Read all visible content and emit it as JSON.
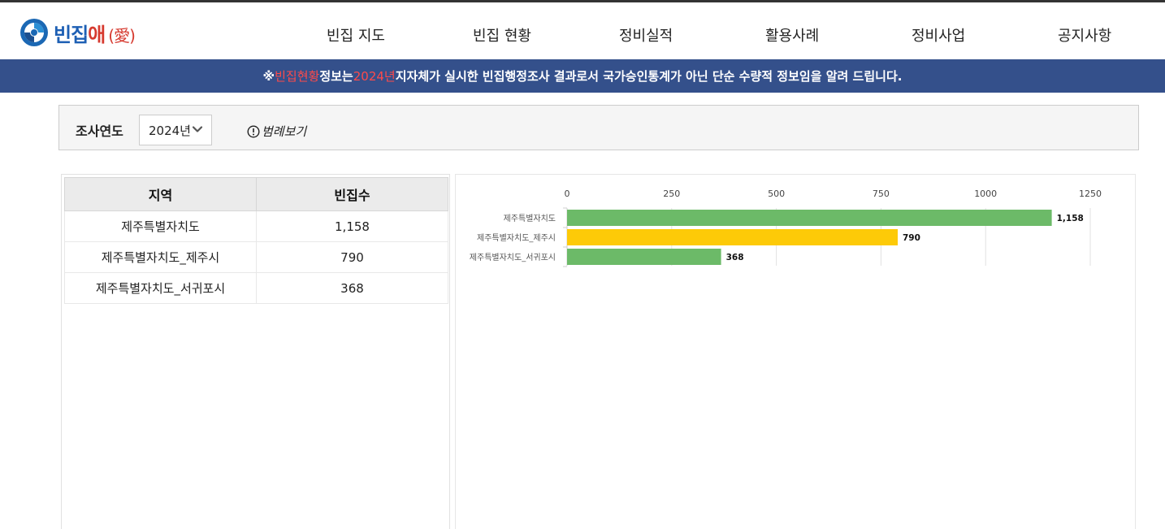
{
  "header": {
    "logo": {
      "text_main": "빈집",
      "text_accent": "애",
      "text_paren": "(愛)"
    },
    "nav": [
      {
        "label": "빈집 지도"
      },
      {
        "label": "빈집 현황"
      },
      {
        "label": "정비실적"
      },
      {
        "label": "활용사례"
      },
      {
        "label": "정비사업"
      },
      {
        "label": "공지사항"
      }
    ]
  },
  "notice": {
    "prefix": "※ ",
    "highlight1": "빈집현황",
    "part2": " 정보는 ",
    "highlight2": "2024년",
    "part3": " 지자체가 실시한 빈집행정조사 결과로서 국가승인통계가 아닌 단순 수량적 정보임을 알려 드립니다."
  },
  "filter": {
    "label": "조사연도",
    "year_selected": "2024년",
    "legend_link": "범례보기"
  },
  "table": {
    "headers": [
      "지역",
      "빈집수"
    ],
    "rows": [
      {
        "region": "제주특별자치도",
        "count": "1,158"
      },
      {
        "region": "제주특별자치도_제주시",
        "count": "790"
      },
      {
        "region": "제주특별자치도_서귀포시",
        "count": "368"
      }
    ]
  },
  "chart_data": {
    "type": "bar",
    "orientation": "horizontal",
    "categories": [
      "제주특별자치도",
      "제주특별자치도_제주시",
      "제주특별자치도_서귀포시"
    ],
    "values": [
      1158,
      790,
      368
    ],
    "value_labels": [
      "1,158",
      "790",
      "368"
    ],
    "bar_colors": [
      "#6cba68",
      "#fdca08",
      "#6cba68"
    ],
    "xlim": [
      0,
      1250
    ],
    "xticks": [
      "0",
      "250",
      "500",
      "750",
      "1000",
      "1250"
    ],
    "tick_values": [
      0,
      250,
      500,
      750,
      1000,
      1250
    ],
    "grid": true,
    "title": "",
    "xlabel": "",
    "ylabel": ""
  }
}
